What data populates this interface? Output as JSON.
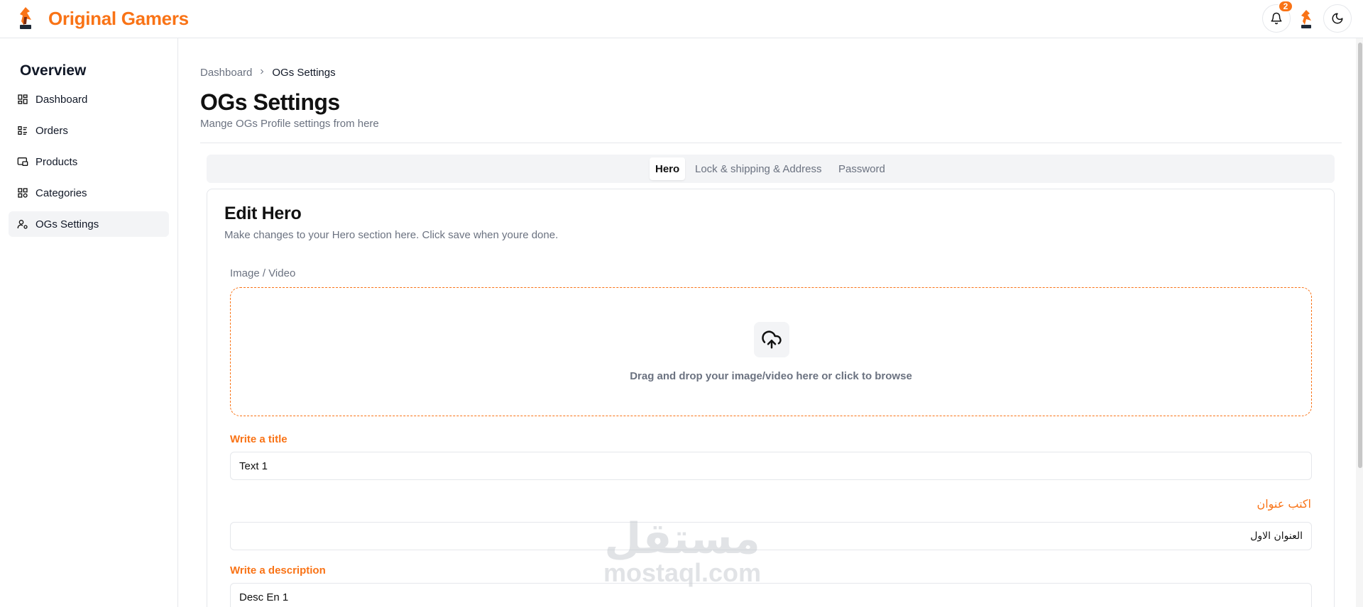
{
  "header": {
    "brand_name": "Original Gamers",
    "notification_count": "2",
    "accent_color": "#f97316"
  },
  "sidebar": {
    "title": "Overview",
    "items": [
      {
        "label": "Dashboard",
        "icon": "grid-icon"
      },
      {
        "label": "Orders",
        "icon": "list-icon"
      },
      {
        "label": "Products",
        "icon": "products-icon"
      },
      {
        "label": "Categories",
        "icon": "categories-icon"
      },
      {
        "label": "OGs Settings",
        "icon": "user-settings-icon",
        "active": true
      }
    ]
  },
  "breadcrumb": {
    "root": "Dashboard",
    "current": "OGs Settings"
  },
  "page": {
    "title": "OGs Settings",
    "subtitle": "Mange OGs Profile settings from here"
  },
  "tabs": [
    {
      "label": "Hero",
      "active": true
    },
    {
      "label": "Lock & shipping & Address"
    },
    {
      "label": "Password"
    }
  ],
  "card": {
    "title": "Edit Hero",
    "subtitle": "Make changes to your Hero section here. Click save when youre done.",
    "media_label": "Image / Video",
    "drop_text": "Drag and drop your image/video here or click to browse",
    "title_en_label": "Write a title",
    "title_en_value": "Text 1",
    "title_ar_label": "اكتب عنوان",
    "title_ar_value": "العنوان الاول",
    "desc_en_label": "Write a description",
    "desc_en_value": "Desc En 1"
  },
  "watermark": {
    "arabic": "مستقل",
    "latin": "mostaql.com"
  }
}
